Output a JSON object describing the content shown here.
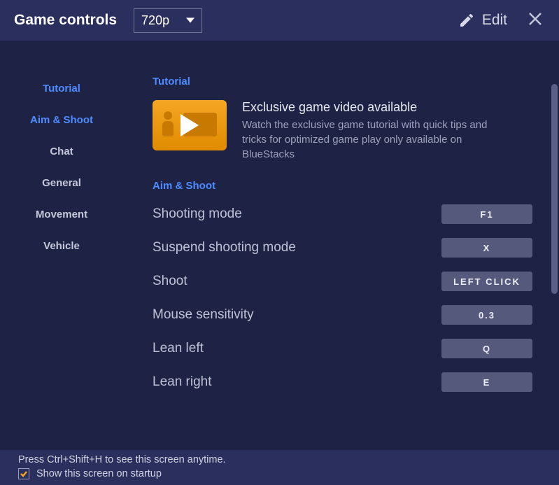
{
  "titlebar": {
    "title": "Game controls",
    "resolution": "720p",
    "edit_label": "Edit"
  },
  "sidebar": {
    "items": [
      {
        "label": "Tutorial",
        "active": true
      },
      {
        "label": "Aim & Shoot",
        "active": true
      },
      {
        "label": "Chat",
        "active": false
      },
      {
        "label": "General",
        "active": false
      },
      {
        "label": "Movement",
        "active": false
      },
      {
        "label": "Vehicle",
        "active": false
      }
    ]
  },
  "sections": {
    "tutorial_heading": "Tutorial",
    "tutorial_title": "Exclusive game video available",
    "tutorial_desc": "Watch the exclusive game tutorial with quick tips and tricks for optimized game play only available on BlueStacks",
    "aim_heading": "Aim & Shoot",
    "controls": [
      {
        "label": "Shooting mode",
        "key": "F1"
      },
      {
        "label": "Suspend shooting mode",
        "key": "X"
      },
      {
        "label": "Shoot",
        "key": "LEFT CLICK"
      },
      {
        "label": "Mouse sensitivity",
        "key": "0.3"
      },
      {
        "label": "Lean left",
        "key": "Q"
      },
      {
        "label": "Lean right",
        "key": "E"
      }
    ]
  },
  "footer": {
    "hint": "Press Ctrl+Shift+H to see this screen anytime.",
    "show_label": "Show this screen on startup",
    "show_checked": true
  }
}
